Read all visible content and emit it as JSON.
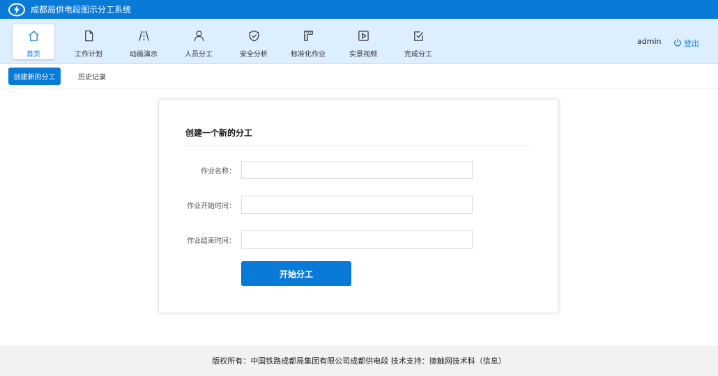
{
  "app": {
    "title": "成都局供电段图示分工系统",
    "logo_icon": "lightning-circle-icon",
    "accent_color": "#0a7ad9"
  },
  "nav": {
    "items": [
      {
        "label": "首页",
        "icon": "home-icon",
        "active": true
      },
      {
        "label": "工作计划",
        "icon": "document-icon",
        "active": false
      },
      {
        "label": "动画演示",
        "icon": "road-icon",
        "active": false
      },
      {
        "label": "人员分工",
        "icon": "person-icon",
        "active": false
      },
      {
        "label": "安全分析",
        "icon": "shield-check-icon",
        "active": false
      },
      {
        "label": "标准化作业",
        "icon": "ruler-icon",
        "active": false
      },
      {
        "label": "实景视频",
        "icon": "play-icon",
        "active": false
      },
      {
        "label": "完成分工",
        "icon": "checkbox-icon",
        "active": false
      }
    ]
  },
  "user": {
    "name": "admin",
    "logout_label": "登出",
    "logout_icon": "power-icon"
  },
  "subtabs": {
    "create_label": "创建新的分工",
    "history_label": "历史记录"
  },
  "form": {
    "title": "创建一个新的分工",
    "fields": [
      {
        "label": "作业名称：",
        "value": ""
      },
      {
        "label": "作业开始时间：",
        "value": ""
      },
      {
        "label": "作业结束时间：",
        "value": ""
      }
    ],
    "submit_label": "开始分工"
  },
  "footer": {
    "text": "版权所有：中国铁路成都局集团有限公司成都供电段 技术支持：接触网技术科（信息）"
  }
}
